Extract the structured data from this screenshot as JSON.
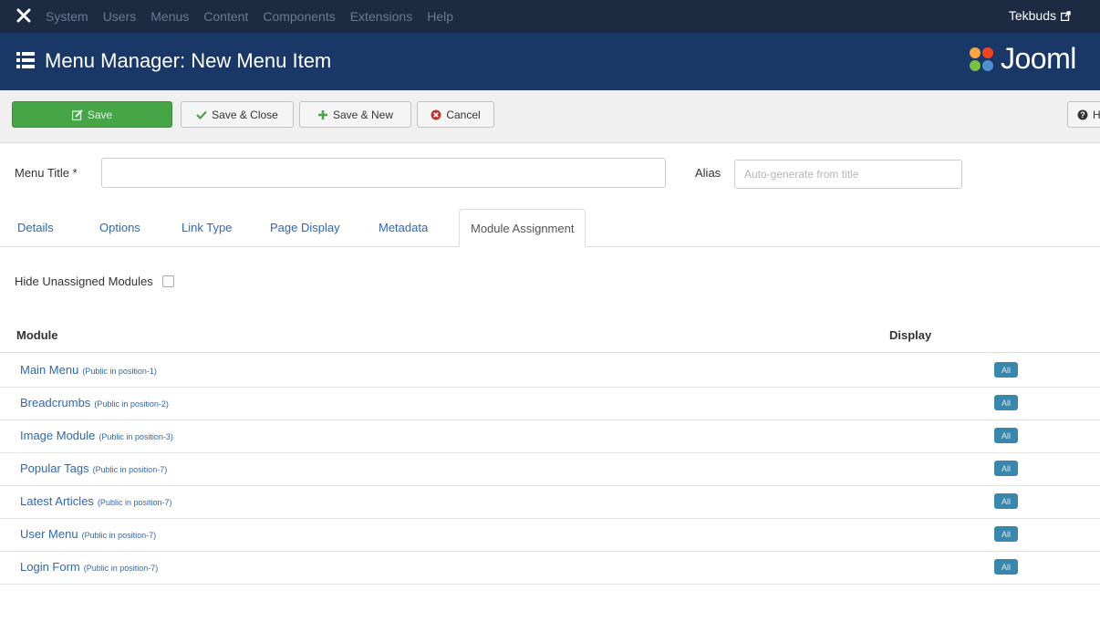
{
  "topbar": {
    "menu": [
      "System",
      "Users",
      "Menus",
      "Content",
      "Components",
      "Extensions",
      "Help"
    ],
    "user": "Tekbuds"
  },
  "header": {
    "title": "Menu Manager: New Menu Item",
    "brand": "Jooml"
  },
  "toolbar": {
    "save": "Save",
    "save_close": "Save & Close",
    "save_new": "Save & New",
    "cancel": "Cancel",
    "help": "H"
  },
  "form": {
    "menu_title_label": "Menu Title *",
    "menu_title_value": "",
    "alias_label": "Alias",
    "alias_placeholder": "Auto-generate from title"
  },
  "tabs": [
    "Details",
    "Options",
    "Link Type",
    "Page Display",
    "Metadata",
    "Module Assignment"
  ],
  "hide_unassigned_label": "Hide Unassigned Modules",
  "table": {
    "headers": {
      "module": "Module",
      "display": "Display"
    },
    "rows": [
      {
        "name": "Main Menu",
        "meta": "(Public in position-1)",
        "display": "All"
      },
      {
        "name": "Breadcrumbs",
        "meta": "(Public in position-2)",
        "display": "All"
      },
      {
        "name": "Image Module",
        "meta": "(Public in position-3)",
        "display": "All"
      },
      {
        "name": "Popular Tags",
        "meta": "(Public in position-7)",
        "display": "All"
      },
      {
        "name": "Latest Articles",
        "meta": "(Public in position-7)",
        "display": "All"
      },
      {
        "name": "User Menu",
        "meta": "(Public in position-7)",
        "display": "All"
      },
      {
        "name": "Login Form",
        "meta": "(Public in position-7)",
        "display": "All"
      }
    ]
  },
  "colors": {
    "topbar": "#1c2b41",
    "header": "#1a3867",
    "save_button": "#46a546",
    "link": "#2a69b8",
    "badge": "#3a87ad"
  },
  "icons": {
    "topbar_logo": "joomla-icon",
    "user_link": "external-link-icon",
    "header": "list-icon",
    "save": "edit-icon",
    "save_close": "check-icon",
    "save_new": "plus-icon",
    "cancel": "cancel-circle-icon",
    "help": "question-circle-icon"
  }
}
